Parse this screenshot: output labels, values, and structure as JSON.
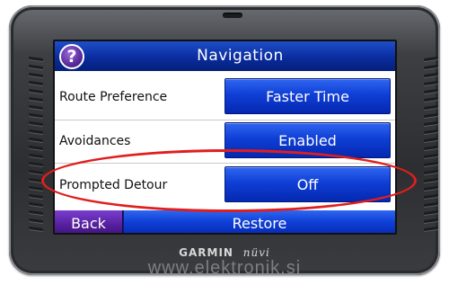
{
  "device": {
    "brand": "GARMIN",
    "model": "nüvi"
  },
  "screen": {
    "title": "Navigation",
    "help_icon": "question-icon",
    "rows": [
      {
        "label": "Route Preference",
        "value": "Faster Time"
      },
      {
        "label": "Avoidances",
        "value": "Enabled"
      },
      {
        "label": "Prompted Detour",
        "value": "Off"
      }
    ],
    "bottom": {
      "back_label": "Back",
      "restore_label": "Restore"
    }
  },
  "watermark": "www.elektronik.si",
  "colors": {
    "title_bar": "#0a2c9e",
    "button_blue": "#0f3fd6",
    "back_purple": "#56209e",
    "highlight_red": "#e01e1e"
  }
}
